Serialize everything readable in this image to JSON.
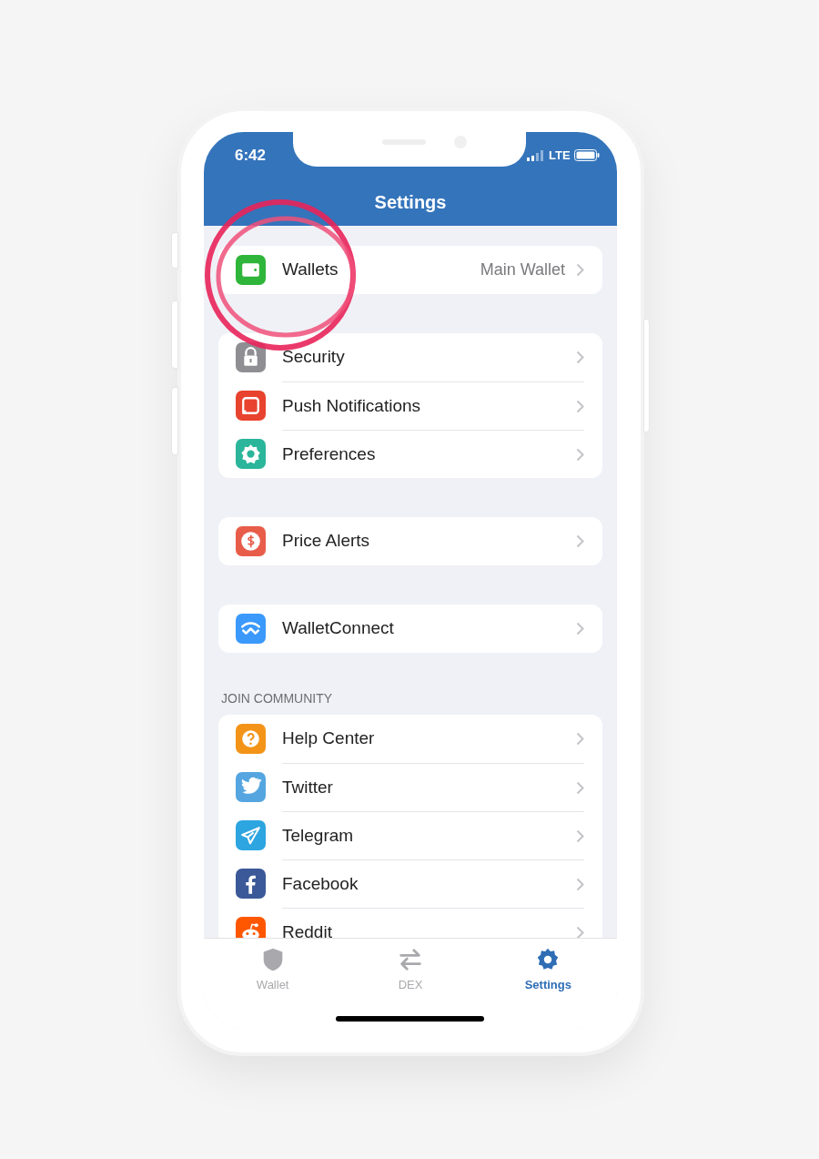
{
  "status_bar": {
    "time": "6:42",
    "network": "LTE"
  },
  "title": "Settings",
  "groups": [
    {
      "items": [
        {
          "label": "Wallets",
          "value": "Main Wallet",
          "color": "#2fb53a",
          "annotated": true
        }
      ]
    },
    {
      "items": [
        {
          "label": "Security",
          "color": "#8e8e93"
        },
        {
          "label": "Push Notifications",
          "color": "#e8432e"
        },
        {
          "label": "Preferences",
          "color": "#2bb59a"
        }
      ]
    },
    {
      "items": [
        {
          "label": "Price Alerts",
          "color": "#e85d4a"
        }
      ]
    },
    {
      "items": [
        {
          "label": "WalletConnect",
          "color": "#3b99fc"
        }
      ]
    },
    {
      "header": "JOIN COMMUNITY",
      "items": [
        {
          "label": "Help Center",
          "color": "#f39419"
        },
        {
          "label": "Twitter",
          "color": "#55a6e0"
        },
        {
          "label": "Telegram",
          "color": "#2ca5e0"
        },
        {
          "label": "Facebook",
          "color": "#3b5998"
        },
        {
          "label": "Reddit",
          "color": "#ff5700"
        }
      ]
    }
  ],
  "tab_bar": [
    {
      "label": "Wallet",
      "selected": false
    },
    {
      "label": "DEX",
      "selected": false
    },
    {
      "label": "Settings",
      "selected": true
    }
  ]
}
